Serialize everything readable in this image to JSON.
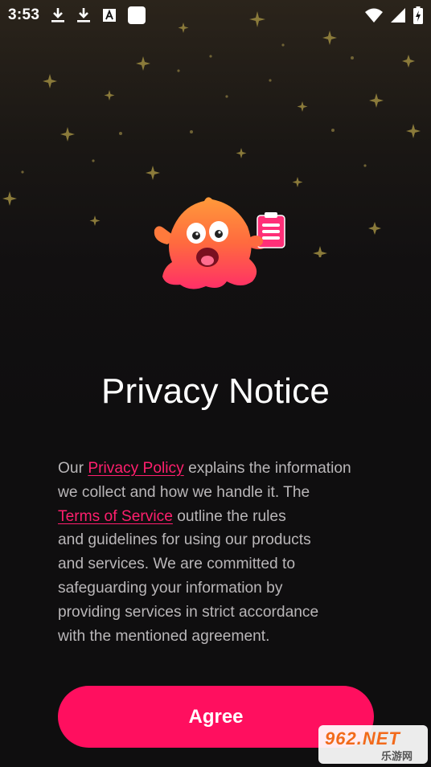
{
  "status_bar": {
    "time": "3:53",
    "left_icons": [
      "download-icon",
      "download-icon",
      "app-notification-icon",
      "square-notification-icon"
    ],
    "right_icons": [
      "wifi-icon",
      "signal-icon",
      "battery-charging-icon"
    ]
  },
  "mascot": {
    "name": "orange-blob-mascot-with-clipboard"
  },
  "title": "Privacy Notice",
  "body": {
    "l1_pre": "Our ",
    "privacy_link": "Privacy Policy",
    "l1_post": " explains the information",
    "l2": "we collect and how we handle it. The",
    "terms_link": "Terms of Service",
    "l3_post": " outline the rules",
    "l4": "and guidelines for using our products",
    "l5": "and services. We are committed to",
    "l6": "safeguarding your information by",
    "l7": "providing services in strict accordance",
    "l8": "with the mentioned agreement."
  },
  "agree_label": "Agree",
  "watermark": {
    "top": "962.NET",
    "bottom": "乐游网"
  },
  "colors": {
    "accent": "#ff0f5f",
    "link": "#ff1f6d",
    "background": "#0f0e0f",
    "body_text": "#b9b6b8"
  }
}
